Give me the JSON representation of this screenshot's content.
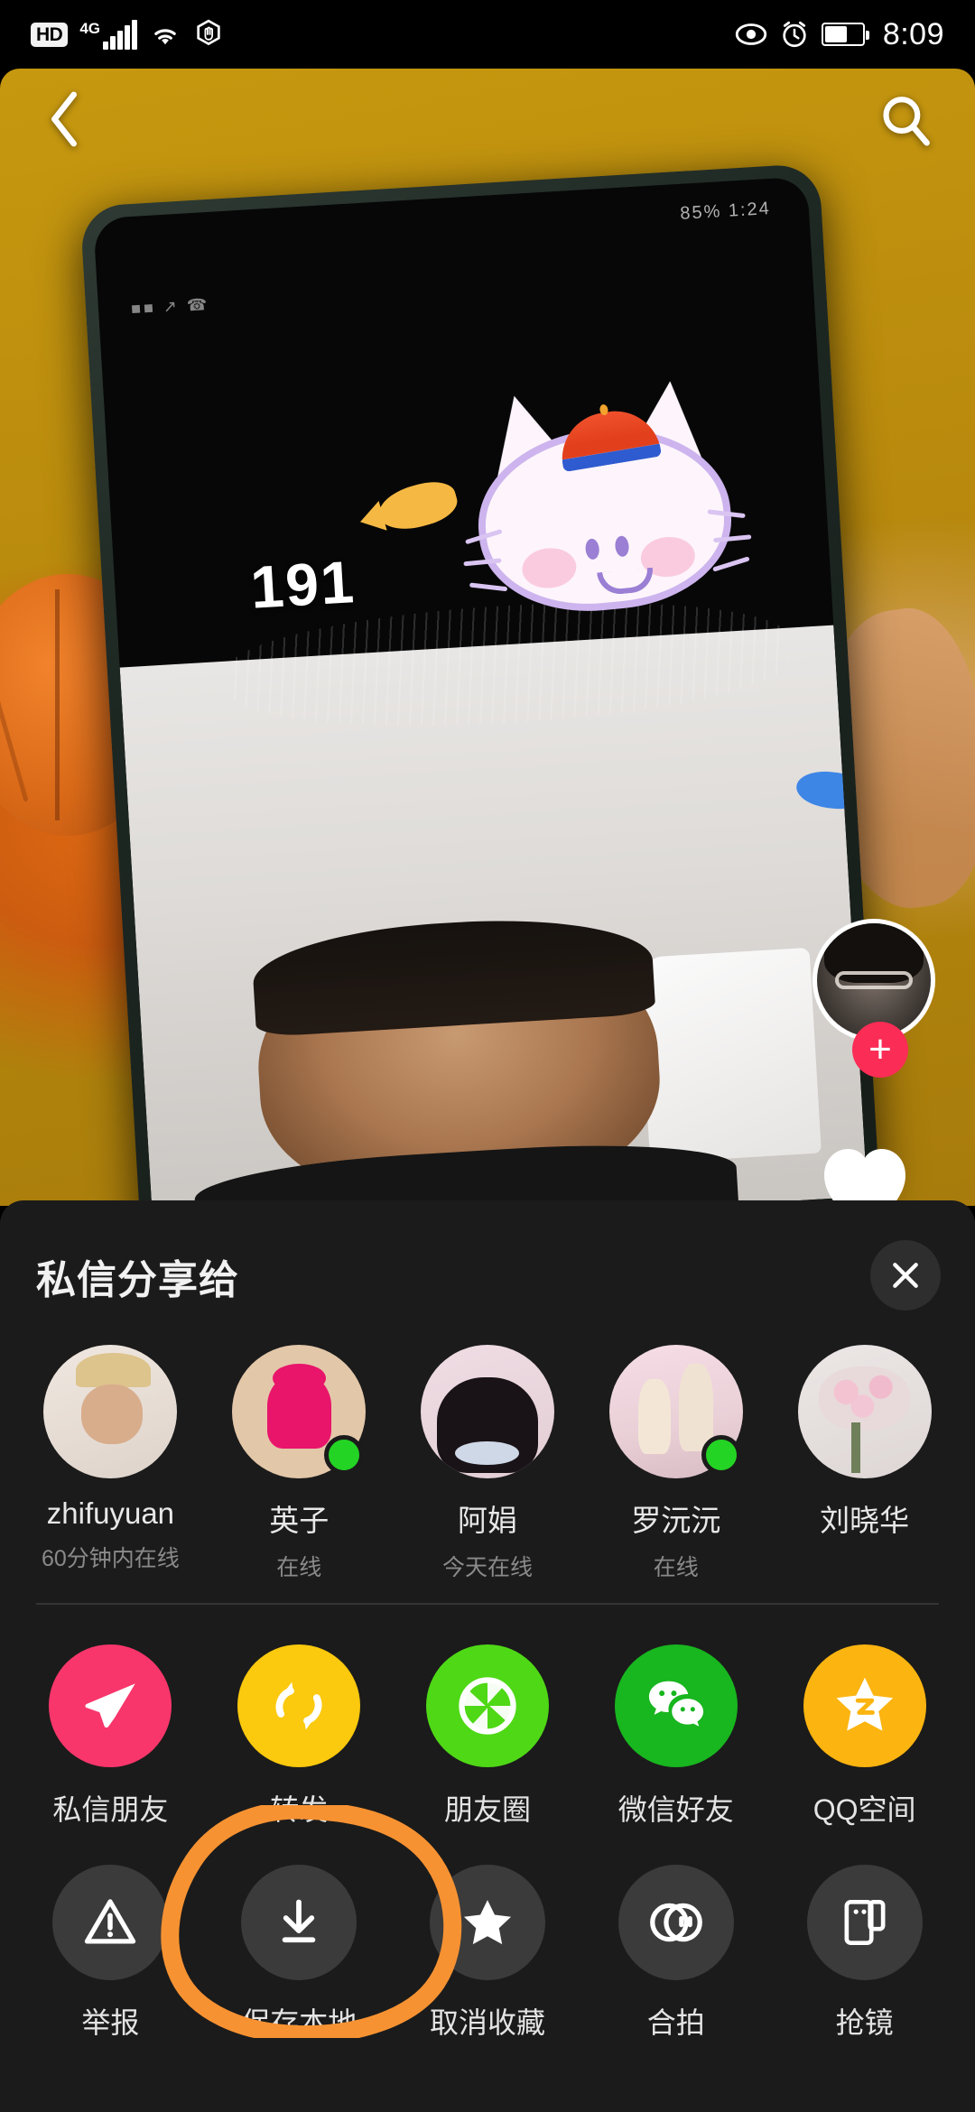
{
  "status_bar": {
    "hd_label": "HD",
    "network": "4G",
    "time": "8:09",
    "icons": [
      "hd-badge-icon",
      "signal-bars-icon",
      "wifi-icon",
      "stop-hand-icon",
      "eye-icon",
      "alarm-clock-icon",
      "battery-icon"
    ],
    "battery_level_pct": 55
  },
  "topnav": {
    "back_icon": "chevron-left-icon",
    "search_icon": "search-icon"
  },
  "video": {
    "inner_phone_status": "85%  1:24",
    "inner_phone_left_status": "■■ ↗ ☎",
    "counter": "191",
    "follow_plus": "+",
    "stickers": [
      "cat-sticker",
      "orange-fish-sticker",
      "blue-fish-sticker",
      "red-blue-cap"
    ]
  },
  "sheet": {
    "title": "私信分享给",
    "close_icon": "close-icon"
  },
  "contacts": [
    {
      "name": "zhifuyuan",
      "status": "60分钟内在线",
      "online": false,
      "avatar": "av1"
    },
    {
      "name": "英子",
      "status": "在线",
      "online": true,
      "avatar": "av2"
    },
    {
      "name": "阿娟",
      "status": "今天在线",
      "online": false,
      "avatar": "av3"
    },
    {
      "name": "罗沅沅",
      "status": "在线",
      "online": true,
      "avatar": "av4"
    },
    {
      "name": "刘晓华",
      "status": "",
      "online": false,
      "avatar": "av5"
    }
  ],
  "share_actions": [
    {
      "label": "私信朋友",
      "icon": "paper-plane-icon",
      "color": "#f8366b"
    },
    {
      "label": "转发",
      "icon": "repost-arrows-icon",
      "color": "#fbc90d"
    },
    {
      "label": "朋友圈",
      "icon": "moments-aperture-icon",
      "color": "#4fd816"
    },
    {
      "label": "微信好友",
      "icon": "wechat-icon",
      "color": "#18b61f"
    },
    {
      "label": "QQ空间",
      "icon": "qzone-star-icon",
      "color": "#fcb410"
    }
  ],
  "tool_actions": [
    {
      "label": "举报",
      "icon": "warning-triangle-icon",
      "highlighted": false
    },
    {
      "label": "保存本地",
      "icon": "download-icon",
      "highlighted": true
    },
    {
      "label": "取消收藏",
      "icon": "star-filled-icon",
      "highlighted": false
    },
    {
      "label": "合拍",
      "icon": "duet-circles-icon",
      "highlighted": false
    },
    {
      "label": "抢镜",
      "icon": "react-frame-icon",
      "highlighted": false
    }
  ],
  "annotation": {
    "type": "hand-drawn-circle",
    "color": "#f79232",
    "targets": "保存本地"
  }
}
